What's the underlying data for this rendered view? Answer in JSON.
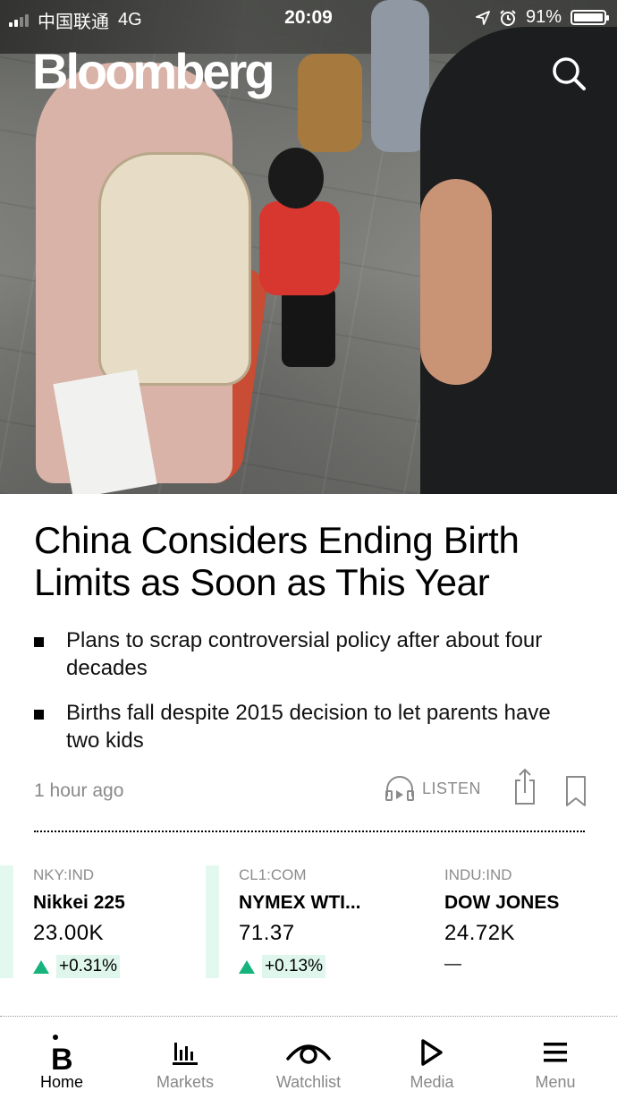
{
  "status_bar": {
    "carrier": "中国联通",
    "network": "4G",
    "time": "20:09",
    "battery": "91%"
  },
  "header": {
    "logo": "Bloomberg",
    "search_icon": "search-icon"
  },
  "article": {
    "headline": "China Considers Ending Birth Limits as Soon as This Year",
    "bullets": [
      "Plans to scrap controversial policy after about four decades",
      "Births fall despite 2015 decision to let parents have two kids"
    ],
    "timestamp": "1 hour ago",
    "listen_label": "LISTEN"
  },
  "tickers": [
    {
      "code": "NKY:IND",
      "name": "Nikkei 225",
      "price": "23.00K",
      "change": "+0.31%",
      "direction": "up"
    },
    {
      "code": "CL1:COM",
      "name": "NYMEX WTI...",
      "price": "71.37",
      "change": "+0.13%",
      "direction": "up"
    },
    {
      "code": "INDU:IND",
      "name": "DOW JONES",
      "price": "24.72K",
      "change": "—",
      "direction": "flat"
    }
  ],
  "tabbar": {
    "items": [
      {
        "label": "Home",
        "icon": "bloomberg-b-icon",
        "active": true
      },
      {
        "label": "Markets",
        "icon": "bar-chart-icon",
        "active": false
      },
      {
        "label": "Watchlist",
        "icon": "eye-icon",
        "active": false
      },
      {
        "label": "Media",
        "icon": "play-icon",
        "active": false
      },
      {
        "label": "Menu",
        "icon": "hamburger-icon",
        "active": false
      }
    ]
  },
  "colors": {
    "accent_green": "#16b47c",
    "ticker_highlight": "#dff6ec",
    "muted_text": "#8a8a8a"
  }
}
